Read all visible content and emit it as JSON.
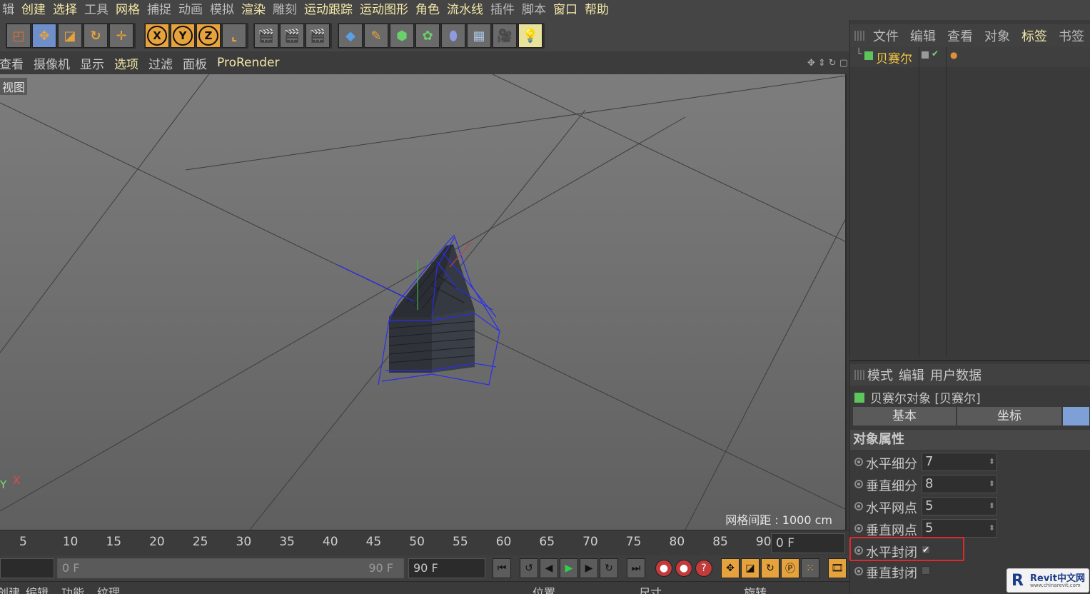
{
  "menubar": {
    "items": [
      "辑",
      "创建",
      "选择",
      "工具",
      "网格",
      "捕捉",
      "动画",
      "模拟",
      "渲染",
      "雕刻",
      "运动跟踪",
      "运动图形",
      "角色",
      "流水线",
      "插件",
      "脚本",
      "窗口",
      "帮助"
    ]
  },
  "toolbar": {
    "axis_x": "X",
    "axis_y": "Y",
    "axis_z": "Z"
  },
  "viewport_menu": {
    "items": [
      "查看",
      "摄像机",
      "显示",
      "选项",
      "过滤",
      "面板",
      "ProRender"
    ]
  },
  "viewport": {
    "label": "视图",
    "grid_info": "网格间距 : 1000 cm",
    "axis_y": "Y",
    "axis_x": "X"
  },
  "timeline": {
    "ticks": [
      "5",
      "10",
      "15",
      "20",
      "25",
      "30",
      "35",
      "40",
      "45",
      "50",
      "55",
      "60",
      "65",
      "70",
      "75",
      "80",
      "85",
      "90"
    ],
    "current_frame": "0 F"
  },
  "playback": {
    "start": "0 F",
    "end_preview": "90 F",
    "end": "90 F"
  },
  "bottom": {
    "left_tabs": [
      "创建",
      "编辑",
      "功能",
      "纹理"
    ],
    "coords": [
      "位置",
      "尺寸",
      "旋转"
    ]
  },
  "objects_panel": {
    "menu": [
      "文件",
      "编辑",
      "查看",
      "对象",
      "标签",
      "书签"
    ],
    "object_name": "贝赛尔"
  },
  "attributes_panel": {
    "menu": [
      "模式",
      "编辑",
      "用户数据"
    ],
    "title": "贝赛尔对象 [贝赛尔]",
    "tabs": [
      "基本",
      "坐标",
      ""
    ],
    "section": "对象属性",
    "params": [
      {
        "label": "水平细分",
        "value": "7"
      },
      {
        "label": "垂直细分",
        "value": "8"
      },
      {
        "label": "水平网点",
        "value": "5"
      },
      {
        "label": "垂直网点",
        "value": "5"
      }
    ],
    "checks": [
      {
        "label": "水平封闭",
        "checked": true
      },
      {
        "label": "垂直封闭",
        "checked": false
      }
    ]
  },
  "watermark": {
    "text": "Revit中文网",
    "sub": "www.chinarevit.com"
  }
}
